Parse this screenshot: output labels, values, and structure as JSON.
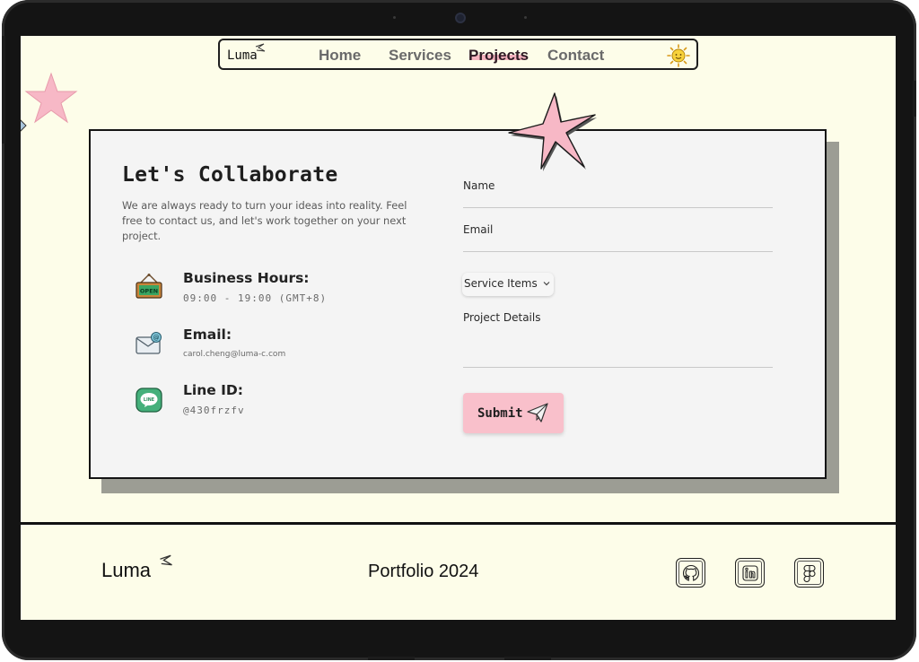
{
  "nav": {
    "logo": "Luma",
    "items": [
      {
        "label": "Home"
      },
      {
        "label": "Services"
      },
      {
        "label": "Projects",
        "active": true
      },
      {
        "label": "Contact"
      }
    ],
    "theme_toggle_icon": "sun-icon"
  },
  "contact": {
    "title": "Let's Collaborate",
    "intro": "We are always ready to turn your ideas into reality. Feel free to contact us, and let's work together on your next project.",
    "info": [
      {
        "icon": "open-sign-icon",
        "title": "Business Hours:",
        "value": "09:00 - 19:00 (GMT+8)",
        "icon_text": "OPEN"
      },
      {
        "icon": "mail-icon",
        "title": "Email:",
        "value": "carol.cheng@luma-c.com"
      },
      {
        "icon": "line-icon",
        "title": "Line ID:",
        "value": "@430frzfv",
        "icon_text": "LINE"
      }
    ]
  },
  "form": {
    "name_label": "Name",
    "email_label": "Email",
    "service_label": "Service Items",
    "details_label": "Project Details",
    "submit_label": "Submit"
  },
  "footer": {
    "logo": "Luma",
    "title": "Portfolio 2024",
    "social": [
      "github-icon",
      "linkedin-icon",
      "figma-icon"
    ]
  },
  "colors": {
    "background": "#fdfde9",
    "card": "#f4f4f4",
    "accent_pink": "#f9c0cb",
    "card_shadow": "#9c9d94"
  }
}
